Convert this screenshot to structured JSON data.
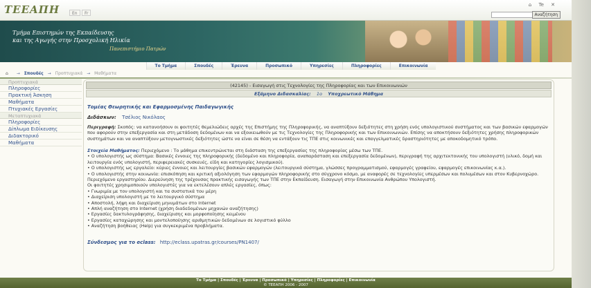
{
  "header": {
    "logo": "ΤΕΕΑΠΗ",
    "lang_en": "En",
    "lang_fr": "Fr",
    "icon_home": "⌂",
    "icon_text": "Te",
    "icon_close": "✕",
    "search_placeholder": "",
    "search_button": "Αναζήτηση"
  },
  "banner": {
    "line1": "Τμήμα Επιστημών της Εκπαίδευσης",
    "line2": "και της Αγωγής στην Προσχολική Ηλικία",
    "line3": "Πανεπιστήμιο Πατρών"
  },
  "nav": [
    "Το Τμήμα",
    "Σπουδές",
    "Έρευνα",
    "Προσωπικό",
    "Υπηρεσίες",
    "Πληροφορίες",
    "Επικοινωνία"
  ],
  "breadcrumb": {
    "home_icon": "⌂",
    "sep": "→",
    "items": [
      "Σπουδές",
      "Προπτυχιακά",
      "Μαθήματα"
    ]
  },
  "sidebar": {
    "undergrad_head": "Προπτυχιακά",
    "undergrad_items": [
      "Πληροφορίες",
      "Πρακτική Άσκηση",
      "Μαθήματα",
      "Πτυχιακές Εργασίες"
    ],
    "postgrad_head": "Μεταπτυχιακά",
    "postgrad_items": [
      "Πληροφορίες",
      "Δίπλωμα Ειδίκευσης",
      "Διδακτορικό",
      "Μαθήματα"
    ]
  },
  "course": {
    "title": "(42145) - Εισαγωγή στις Τεχνολογίες της Πληροφορίας και των Επικοινωνιών",
    "semester_label": "Εξάμηνο Διδασκαλίας:",
    "semester_value": "1ο",
    "type": "Υποχρεωτικό Μάθημα",
    "sector": "Τομέας Θεωρητικής και Εφαρμοσμένης Παιδαγωγικής",
    "teachers_label": "Διδάσκων:",
    "teacher_name": "Τσέλιος Νικόλαος",
    "desc_label": "Περιγραφή:",
    "desc_text": "Σκοπός: να κατανοήσουν οι φοιτητές θεμελιώδεις αρχές της Επιστήμης της Πληροφορικής, να αναπτύξουν δεξιότητες στη χρήση ενός υπολογιστικού συστήματος και των βασικών εφαρμογών που αφορούν στην επεξεργασία και στη μετάδοση δεδομένων και να εξοικειωθούν με τις Τεχνολογίες της Πληροφορικής και των Επικοινωνιών. Επίσης να αποκτήσουν δεξιότητες χρήσης πληροφορικών συστημάτων και να αναπτύξουν μετογνωστικές δεξιότητες ώστε να είναι σε θέση να εντάξουν τις ΤΠΕ στις κοινωνικές και επαγγελματικές δραστηριότητες με αποκοδομητικό τρόπο.",
    "content_label": "Στοιχεία Μαθήματος:",
    "content_intro": "Περιεχόμενο : Το μάθημα επικεντρώνεται στη διάσταση της επεξεργασίας της πληροφορίας μέσω των ΤΠΕ.",
    "content_lines": [
      "• Ο υπολογιστής ως σύστημα: Βασικές έννοιες της πληροφορικής (δεδομένο και πληροφορία, αναπαράσταση και επεξεργασία δεδομένων), περιγραφή της αρχιτεκτονικής του υπολογιστή (υλικό, δομή και λειτουργία ενός υπολογιστή, περιφερειακές συσκευές, είδη και κατηγορίες λογισμικού).",
      "• Ο υπολογιστής ως εργαλείο: κύριες έννοιες και λειτουργίες βασικών εφαρμογών (λειτουργικά σύστημα, γλώσσες προγραμματισμού, εφαρμογές γραφείου, εφαρμογές επικοινωνίας κ.α.).",
      "• Ο υπολογιστής στην κοινωνία: επισκόπηση και κριτική αξιολόγηση των εφαρμογών πληροφορικής στο σύγχρονο κόσμο, με αναφορές σε τεχνολογίες υπερμέσων και πολυμέσων και στον Κυβερνοχώρο.",
      "Περιεχόμενο εργαστηρίου. Διερεύνηση της τρέχουσας πρακτικής εισαγωγής των ΤΠΕ στην Εκπαίδευση. Εισαγωγή στην Επικοινωνία Ανθρώπου Υπολογιστή.",
      "Οι φοιτητές χρησιμοποιούν υπολογιστές για να εκτελέσουν απλές εργασίες, όπως:",
      "• Γνωριμία με τον υπολογιστή και τα συστατικά του μέρη",
      "• Διαχείριση υπολογιστή με το λειτουργικό σύστημα",
      "• Αποστολή, λήψη και διαχείριση μηνυμάτων στο Internet",
      "• Απλή αναζήτηση στο Internet (χρήση διαδεδομένων μηχανών αναζήτησης)",
      "• Εργασίες δακτυλογράφησης, διαχείρισης και μορφοποίησης κειμένου",
      "• Εργασίες καταχώρησης και μοντελοποίησης αριθμητικών δεδομένων σε λογιστικό φύλλο",
      "• Αναζήτηση βοήθειας (Help) για συγκεκριμένα προβλήματα."
    ],
    "eclass_label": "Σύνδεσμος για το eclass:",
    "eclass_link": "http://eclass.upatras.gr/courses/PN1407/"
  },
  "footer": {
    "links": "Το Τμήμα | Σπουδές | Έρευνα | Προσωπικό | Υπηρεσίες | Πληροφορίες | Επικοινωνία",
    "copyright": "© ΤΕΕΑΠΗ 2006 - 2007"
  }
}
